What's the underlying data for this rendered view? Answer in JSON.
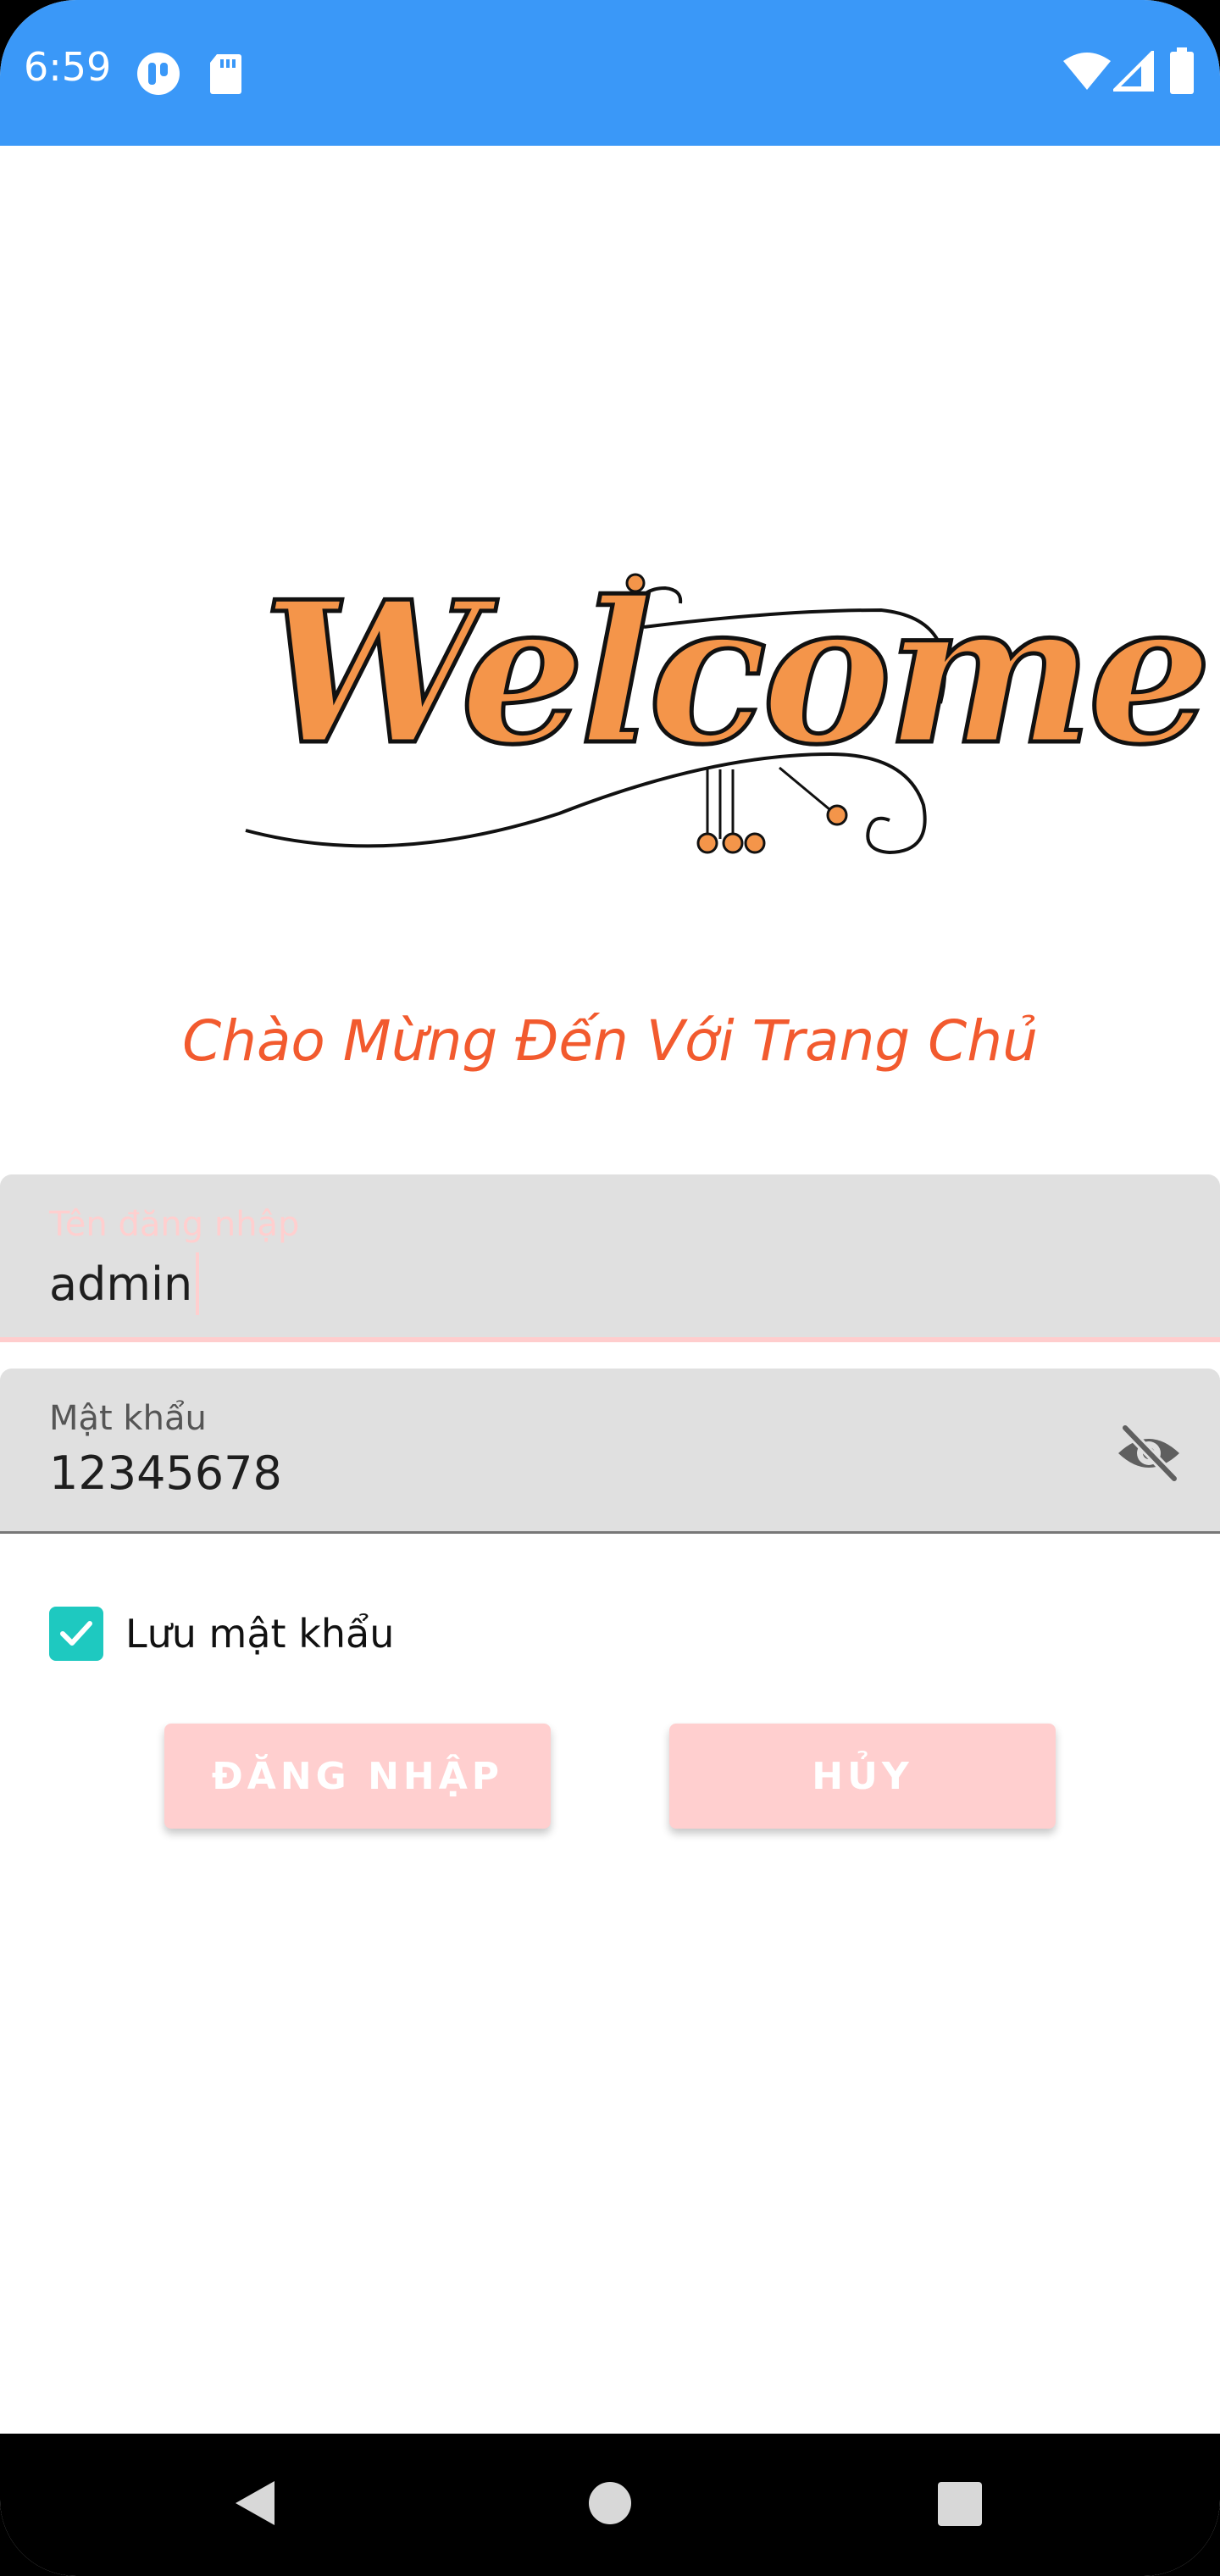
{
  "status_bar": {
    "time": "6:59",
    "left_icons": [
      "tasks-app-icon",
      "sd-card-icon"
    ],
    "right_icons": [
      "wifi-icon",
      "cell-signal-icon",
      "battery-icon"
    ],
    "color": "#3a98f8"
  },
  "logo": {
    "text": "Welcome"
  },
  "subtitle": "Chào Mừng Đến Với Trang Chủ",
  "username_field": {
    "label": "Tên đăng nhập",
    "value": "admin"
  },
  "password_field": {
    "label": "Mật khẩu",
    "value": "12345678",
    "toggle_icon": "eye-off-icon"
  },
  "remember": {
    "label": "Lưu mật khẩu",
    "checked": true
  },
  "buttons": {
    "login": "ĐĂNG NHẬP",
    "cancel": "HỦY"
  },
  "nav_bar": {
    "icons": [
      "back-icon",
      "home-icon",
      "recents-icon"
    ]
  },
  "colors": {
    "accent": "#f25a2e",
    "button": "#ffcfcf",
    "checkbox": "#1ec9c0"
  }
}
